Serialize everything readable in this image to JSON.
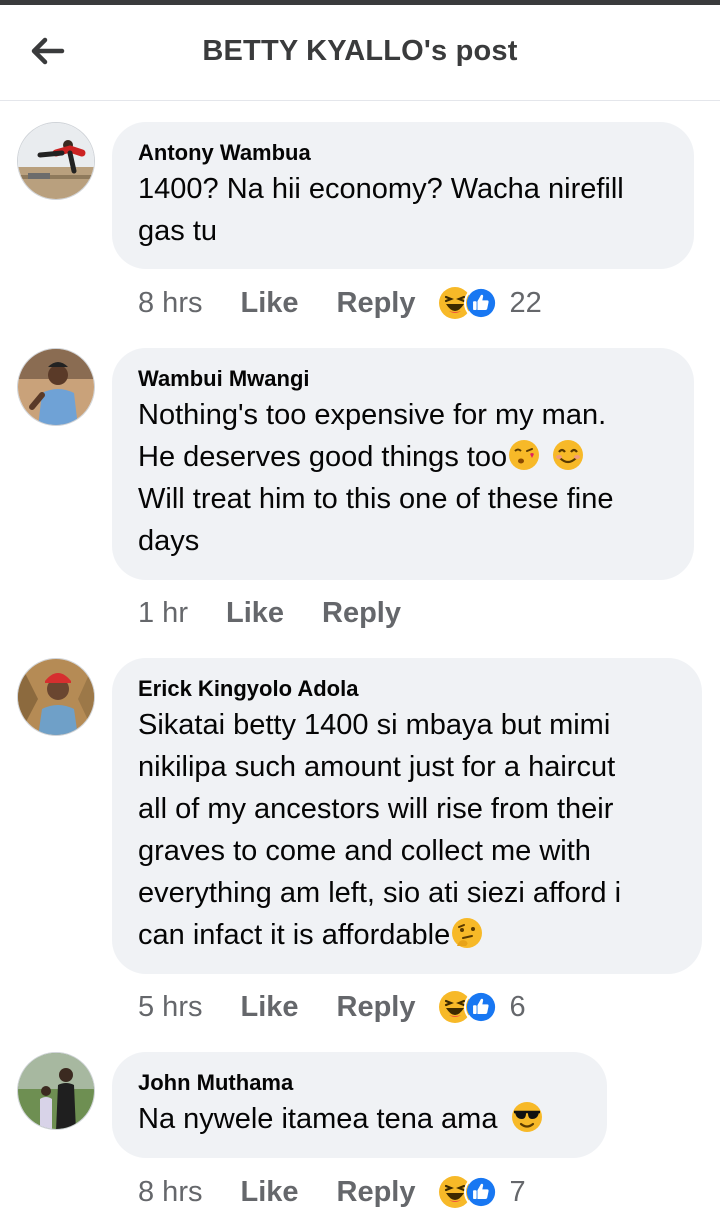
{
  "header": {
    "title": "BETTY KYALLO's post"
  },
  "icons": {
    "back": "arrow-left-icon",
    "haha": "haha-reaction-icon",
    "like": "like-reaction-icon"
  },
  "colors": {
    "like_blue": "#1877f2",
    "haha_yellow": "#f7b928",
    "secondary_text": "#65676b",
    "bubble_bg": "#f0f2f5"
  },
  "comments": [
    {
      "author": "Antony Wambua",
      "lines": [
        "1400? Na hii economy? Wacha nirefill",
        "gas tu"
      ],
      "time": "8 hrs",
      "like": "Like",
      "reply": "Reply",
      "reaction_count": "22"
    },
    {
      "author": "Wambui Mwangi",
      "lines": [
        "Nothing's too expensive for my man.",
        "He deserves good things too",
        "Will treat him to this one of these fine",
        "days"
      ],
      "emojis": [
        "face-blowing-kiss-emoji",
        "smiling-face-emoji"
      ],
      "time": "1 hr",
      "like": "Like",
      "reply": "Reply"
    },
    {
      "author": "Erick Kingyolo Adola",
      "lines": [
        "Sikatai betty 1400 si mbaya but mimi",
        "nikilipa such amount just for a haircut",
        "all of my ancestors will rise from their",
        "graves to come and collect me with",
        "everything am left, sio ati siezi afford i",
        "can infact it is affordable"
      ],
      "emojis": [
        "thinking-face-emoji"
      ],
      "time": "5 hrs",
      "like": "Like",
      "reply": "Reply",
      "reaction_count": "6"
    },
    {
      "author": "John Muthama",
      "lines": [
        "Na nywele itamea tena ama "
      ],
      "emojis": [
        "sunglasses-face-emoji"
      ],
      "time": "8 hrs",
      "like": "Like",
      "reply": "Reply",
      "reaction_count": "7"
    }
  ]
}
